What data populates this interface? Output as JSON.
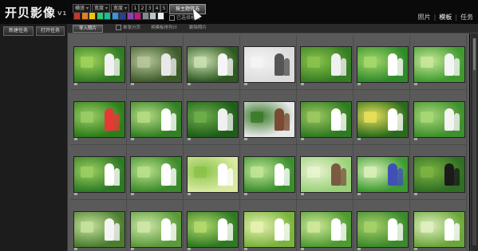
{
  "app": {
    "title": "开贝影像",
    "version": "V1"
  },
  "toolbar": {
    "dropdown_1": "横竖",
    "dropdown_2": "宽度",
    "dropdown_3": "宽度",
    "page_numbers": [
      "1",
      "2",
      "3",
      "4",
      "5"
    ],
    "swatch_colors": [
      "#c0392b",
      "#e67e22",
      "#f1c40f",
      "#2ecc71",
      "#1abc9c",
      "#3498db",
      "#2c3e8f",
      "#8e44ad",
      "#c71585",
      "#7f8c8d",
      "#bdc3c7",
      "#ecf0f1"
    ],
    "theme_button": "按主题筛选",
    "checkbox_label": "已选择模板"
  },
  "view_tabs": {
    "photos": "照片",
    "templates": "模板",
    "tasks": "任务",
    "active": "templates"
  },
  "left_panel": {
    "new_task": "新建任务",
    "open_task": "打开任务"
  },
  "subbar": {
    "import": "导入照片",
    "option_1": "单张分页",
    "option_2": "将模板排列计",
    "option_3": "剔除照片"
  },
  "thumbnails": [
    {
      "bg": "#2f7a22",
      "light": "#9fd25a",
      "fig": "#f2f2f2"
    },
    {
      "bg": "#3e5b2a",
      "light": "#b7c79a",
      "fig": "#e8e8e8"
    },
    {
      "bg": "#2e5a20",
      "light": "#c9dfb0",
      "fig": "#f5f5f5"
    },
    {
      "bg": "#dcdcdc",
      "light": "#f4f4f4",
      "fig": "#555555"
    },
    {
      "bg": "#357d24",
      "light": "#8bc34a",
      "fig": "#f0f0f0"
    },
    {
      "bg": "#2f8a2a",
      "light": "#a5d86b",
      "fig": "#ffffff"
    },
    {
      "bg": "#3f9a2e",
      "light": "#c8e89a",
      "fig": "#f5f5f5"
    },
    {
      "bg": "#2e7d1c",
      "light": "#9ccc65",
      "fig": "#e53935"
    },
    {
      "bg": "#347f26",
      "light": "#b5dc83",
      "fig": "#ffffff"
    },
    {
      "bg": "#1f5e1a",
      "light": "#6fae4a",
      "fig": "#f0f0f0"
    },
    {
      "bg": "#e8e8e8",
      "light": "#3a7a2a",
      "fig": "#7a4b32"
    },
    {
      "bg": "#2f7a22",
      "light": "#9cc860",
      "fig": "#ffffff"
    },
    {
      "bg": "#2c6b1e",
      "light": "#e7e05a",
      "fig": "#ffffff"
    },
    {
      "bg": "#3e8f2e",
      "light": "#a8d878",
      "fig": "#f4f4f4"
    },
    {
      "bg": "#2d7a24",
      "light": "#9ccf60",
      "fig": "#ffffff"
    },
    {
      "bg": "#3b8a2b",
      "light": "#b9e08a",
      "fig": "#ffffff"
    },
    {
      "bg": "#d9eaa0",
      "light": "#8bc34a",
      "fig": "#ffffff"
    },
    {
      "bg": "#3a8e2c",
      "light": "#bfe596",
      "fig": "#ffffff"
    },
    {
      "bg": "#9bd17a",
      "light": "#e8f4d0",
      "fig": "#7a5a40"
    },
    {
      "bg": "#3c9a2f",
      "light": "#d8f0b8",
      "fig": "#3f51b5"
    },
    {
      "bg": "#2f6e24",
      "light": "#7cb342",
      "fig": "#1b1b1b"
    },
    {
      "bg": "#4a7d30",
      "light": "#c7e29c",
      "fig": "#f4f4f4"
    },
    {
      "bg": "#5b9a3a",
      "light": "#cfe8a8",
      "fig": "#ffffff"
    },
    {
      "bg": "#2f7a22",
      "light": "#b3d96c",
      "fig": "#ffffff"
    },
    {
      "bg": "#7ab33d",
      "light": "#e6f2b0",
      "fig": "#ffffff"
    },
    {
      "bg": "#4f9a32",
      "light": "#cfe89a",
      "fig": "#ffffff"
    },
    {
      "bg": "#3c8a2c",
      "light": "#a7d06a",
      "fig": "#ffffff"
    },
    {
      "bg": "#6aa63a",
      "light": "#e0f0c0",
      "fig": "#ffffff"
    }
  ]
}
